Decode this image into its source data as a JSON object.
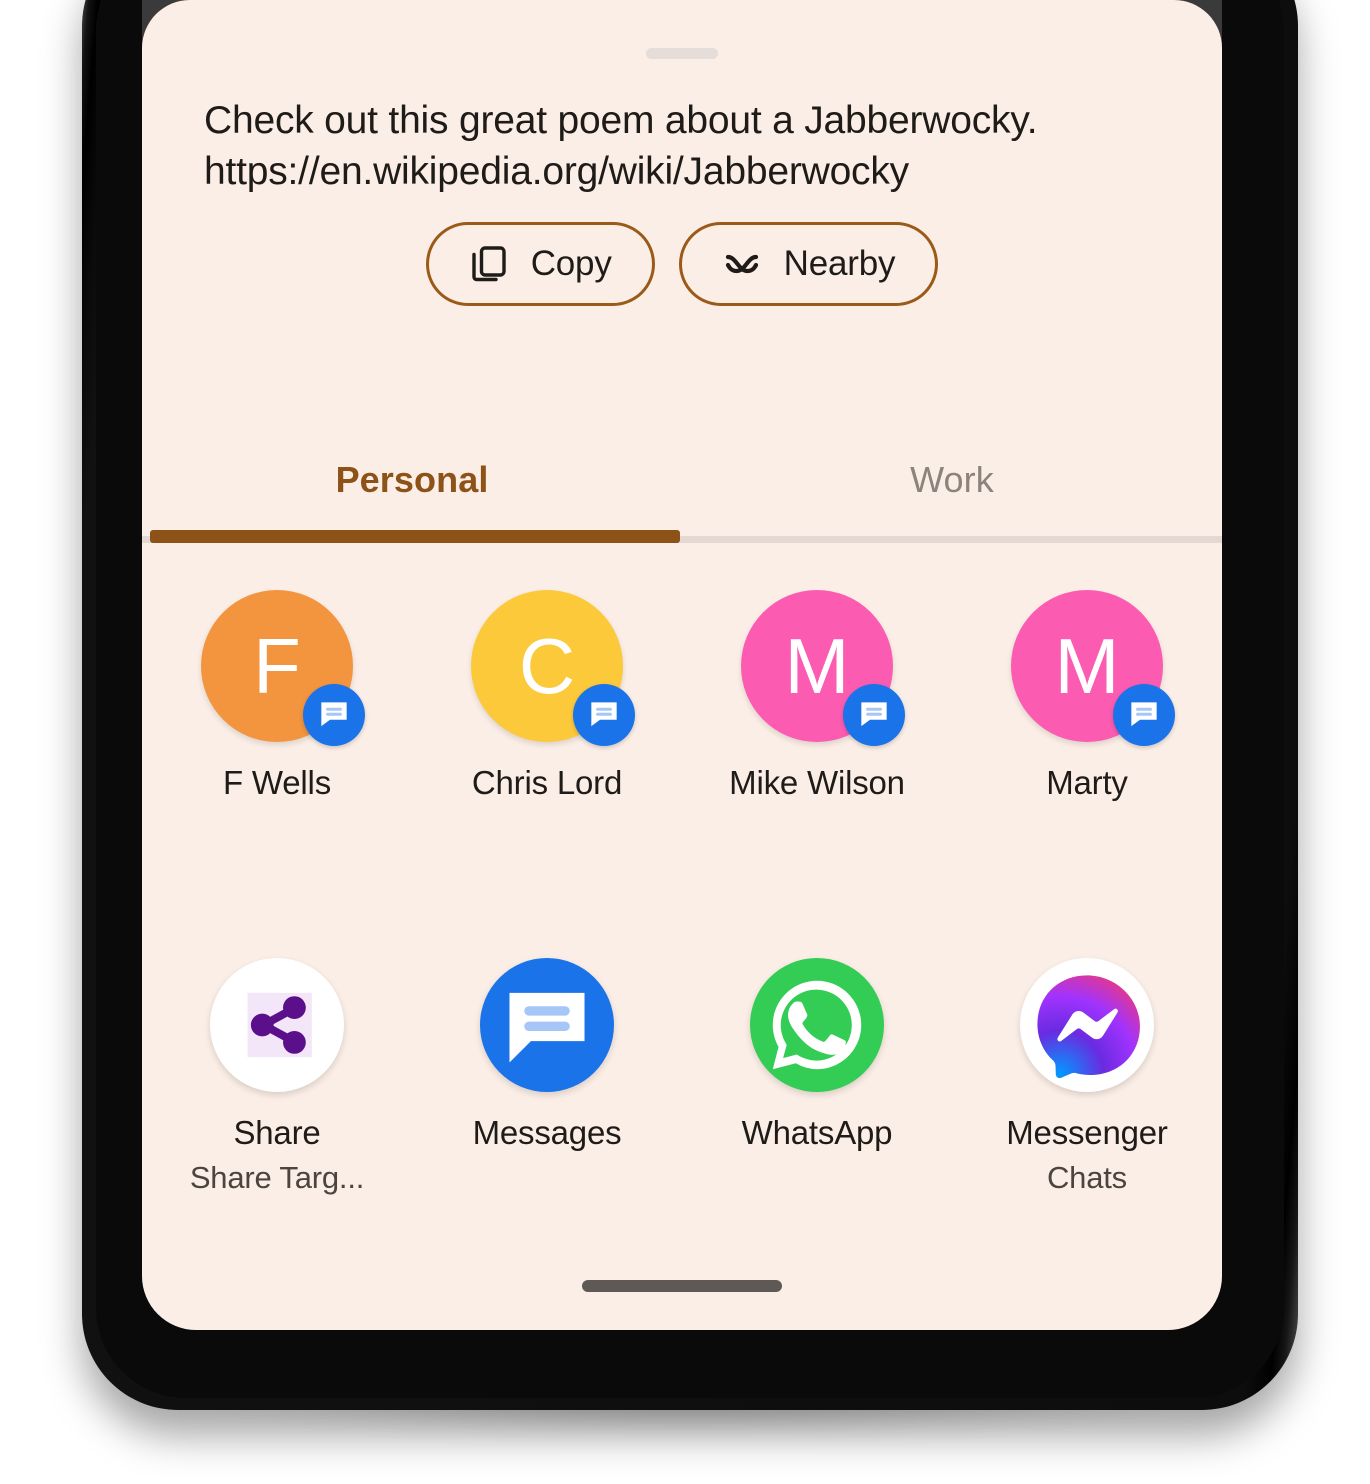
{
  "sheet": {
    "preview_text": "Check out this great poem about a Jabberwocky.\nhttps://en.wikipedia.org/wiki/Jabberwocky",
    "background_color": "#FBEEE6",
    "accent_color": "#8D5218"
  },
  "actions": [
    {
      "label": "Copy",
      "icon": "copy-icon"
    },
    {
      "label": "Nearby",
      "icon": "nearby-share-icon"
    }
  ],
  "tabs": [
    {
      "label": "Personal",
      "active": true
    },
    {
      "label": "Work",
      "active": false
    }
  ],
  "contacts": [
    {
      "name": "F Wells",
      "initial": "F",
      "color": "#F3943F",
      "badge": "messages-icon"
    },
    {
      "name": "Chris Lord",
      "initial": "C",
      "color": "#FBC93A",
      "badge": "messages-icon"
    },
    {
      "name": "Mike Wilson",
      "initial": "M",
      "color": "#FB5BB1",
      "badge": "messages-icon"
    },
    {
      "name": "Marty",
      "initial": "M",
      "color": "#FB5BB1",
      "badge": "messages-icon"
    }
  ],
  "apps": [
    {
      "name": "Share",
      "sublabel": "Share Targ...",
      "icon": "share-nodes-icon"
    },
    {
      "name": "Messages",
      "sublabel": "",
      "icon": "google-messages-icon"
    },
    {
      "name": "WhatsApp",
      "sublabel": "",
      "icon": "whatsapp-icon"
    },
    {
      "name": "Messenger",
      "sublabel": "Chats",
      "icon": "facebook-messenger-icon"
    }
  ]
}
